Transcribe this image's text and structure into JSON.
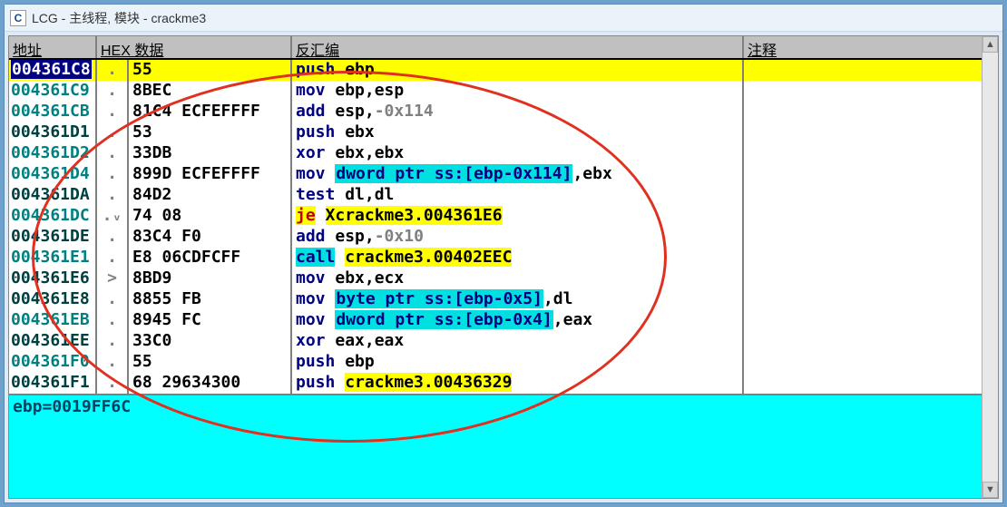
{
  "title": "LCG -  主线程, 模块 - crackme3",
  "app_icon_letter": "C",
  "columns": {
    "addr": "地址",
    "hex": "HEX 数据",
    "dis": "反汇编",
    "cmt": "注释"
  },
  "rows": [
    {
      "address": "004361C8",
      "addr_style": "sel",
      "mark": ".",
      "hex": "55",
      "dis": [
        {
          "t": "push ",
          "c": "mnem"
        },
        {
          "t": "ebp",
          "c": "reg"
        }
      ],
      "selected": true
    },
    {
      "address": "004361C9",
      "addr_style": "teal",
      "mark": ".",
      "hex": "8BEC",
      "dis": [
        {
          "t": "mov ",
          "c": "mnem"
        },
        {
          "t": "ebp",
          "c": "reg"
        },
        {
          "t": ",",
          "c": "reg"
        },
        {
          "t": "esp",
          "c": "reg"
        }
      ]
    },
    {
      "address": "004361CB",
      "addr_style": "teal",
      "mark": ".",
      "hex": "81C4 ECFEFFFF",
      "dis": [
        {
          "t": "add ",
          "c": "mnem"
        },
        {
          "t": "esp",
          "c": "reg"
        },
        {
          "t": ",",
          "c": "reg"
        },
        {
          "t": "-0x114",
          "c": "num"
        }
      ]
    },
    {
      "address": "004361D1",
      "addr_style": "dark",
      "mark": ".",
      "hex": "53",
      "dis": [
        {
          "t": "push ",
          "c": "mnem"
        },
        {
          "t": "ebx",
          "c": "reg"
        }
      ]
    },
    {
      "address": "004361D2",
      "addr_style": "teal",
      "mark": ".",
      "hex": "33DB",
      "dis": [
        {
          "t": "xor ",
          "c": "mnem"
        },
        {
          "t": "ebx",
          "c": "reg"
        },
        {
          "t": ",",
          "c": "reg"
        },
        {
          "t": "ebx",
          "c": "reg"
        }
      ]
    },
    {
      "address": "004361D4",
      "addr_style": "teal",
      "mark": ".",
      "hex": "899D ECFEFFFF",
      "dis": [
        {
          "t": "mov ",
          "c": "mnem"
        },
        {
          "t": "dword ptr ss:[ebp-0x114]",
          "c": "memref"
        },
        {
          "t": ",",
          "c": "reg"
        },
        {
          "t": "ebx",
          "c": "reg"
        }
      ]
    },
    {
      "address": "004361DA",
      "addr_style": "dark",
      "mark": ".",
      "hex": "84D2",
      "dis": [
        {
          "t": "test ",
          "c": "mnem"
        },
        {
          "t": "dl",
          "c": "reg"
        },
        {
          "t": ",",
          "c": "reg"
        },
        {
          "t": "dl",
          "c": "reg"
        }
      ]
    },
    {
      "address": "004361DC",
      "addr_style": "teal",
      "mark": ".ᵥ",
      "hex": "74 08",
      "dis": [
        {
          "t": "je",
          "c": "je-mnem",
          "bg": "je-bg"
        },
        {
          "t": " ",
          "c": "reg"
        },
        {
          "t": "Xcrackme3.004361E6",
          "c": "reg",
          "bg": "je-bg"
        }
      ]
    },
    {
      "address": "004361DE",
      "addr_style": "dark",
      "mark": ".",
      "hex": "83C4 F0",
      "dis": [
        {
          "t": "add ",
          "c": "mnem"
        },
        {
          "t": "esp",
          "c": "reg"
        },
        {
          "t": ",",
          "c": "reg"
        },
        {
          "t": "-0x10",
          "c": "num"
        }
      ]
    },
    {
      "address": "004361E1",
      "addr_style": "teal",
      "mark": ".",
      "hex": "E8 06CDFCFF",
      "dis": [
        {
          "t": "call",
          "c": "call-bg"
        },
        {
          "t": " ",
          "c": "reg"
        },
        {
          "t": "crackme3.00402EEC",
          "c": "callt"
        }
      ]
    },
    {
      "address": "004361E6",
      "addr_style": "dark",
      "mark": ">",
      "hex": "8BD9",
      "dis": [
        {
          "t": "mov ",
          "c": "mnem"
        },
        {
          "t": "ebx",
          "c": "reg"
        },
        {
          "t": ",",
          "c": "reg"
        },
        {
          "t": "ecx",
          "c": "reg"
        }
      ]
    },
    {
      "address": "004361E8",
      "addr_style": "dark",
      "mark": ".",
      "hex": "8855 FB",
      "dis": [
        {
          "t": "mov ",
          "c": "mnem"
        },
        {
          "t": "byte ptr ss:[ebp-0x5]",
          "c": "memref"
        },
        {
          "t": ",",
          "c": "reg"
        },
        {
          "t": "dl",
          "c": "reg"
        }
      ]
    },
    {
      "address": "004361EB",
      "addr_style": "teal",
      "mark": ".",
      "hex": "8945 FC",
      "dis": [
        {
          "t": "mov ",
          "c": "mnem"
        },
        {
          "t": "dword ptr ss:[ebp-0x4]",
          "c": "memref"
        },
        {
          "t": ",",
          "c": "reg"
        },
        {
          "t": "eax",
          "c": "reg"
        }
      ]
    },
    {
      "address": "004361EE",
      "addr_style": "dark",
      "mark": ".",
      "hex": "33C0",
      "dis": [
        {
          "t": "xor ",
          "c": "mnem"
        },
        {
          "t": "eax",
          "c": "reg"
        },
        {
          "t": ",",
          "c": "reg"
        },
        {
          "t": "eax",
          "c": "reg"
        }
      ]
    },
    {
      "address": "004361F0",
      "addr_style": "teal",
      "mark": ".",
      "hex": "55",
      "dis": [
        {
          "t": "push ",
          "c": "mnem"
        },
        {
          "t": "ebp",
          "c": "reg"
        }
      ]
    },
    {
      "address": "004361F1",
      "addr_style": "dark",
      "mark": ".",
      "hex": "68 29634300",
      "dis": [
        {
          "t": "push ",
          "c": "mnem"
        },
        {
          "t": "crackme3.00436329",
          "c": "callt"
        }
      ]
    }
  ],
  "info_text": "ebp=0019FF6C",
  "annotation": "red-ellipse"
}
